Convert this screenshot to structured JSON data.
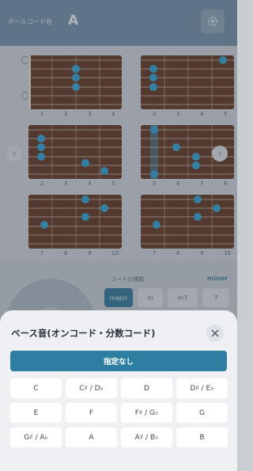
{
  "header": {
    "label": "ボールコード音",
    "key": "A"
  },
  "diagrams": [
    {
      "frets": [
        "1",
        "2",
        "3",
        "4"
      ]
    },
    {
      "frets": [
        "2",
        "3",
        "4",
        "5"
      ]
    },
    {
      "frets": [
        "2",
        "3",
        "4",
        "5"
      ]
    },
    {
      "frets": [
        "5",
        "6",
        "7",
        "8"
      ]
    },
    {
      "frets": [
        "7",
        "8",
        "9",
        "10"
      ]
    },
    {
      "frets": [
        "7",
        "8",
        "9",
        "10"
      ]
    }
  ],
  "controls": {
    "type_label": "コードの種類",
    "minor_label": "minor",
    "types": [
      "major",
      "m",
      "m7",
      "7"
    ]
  },
  "sheet": {
    "title": "ベース音(オンコード・分数コード)",
    "none_label": "指定なし",
    "notes": [
      "C",
      "C♯ / D♭",
      "D",
      "D♯ / E♭",
      "E",
      "F",
      "F♯ / G♭",
      "G",
      "G♯ / A♭",
      "A",
      "A♯ / B♭",
      "B"
    ]
  },
  "colors": {
    "accent": "#2d7ea1",
    "fretboard": "#6b3f27",
    "marker": "#3aa9d6"
  }
}
